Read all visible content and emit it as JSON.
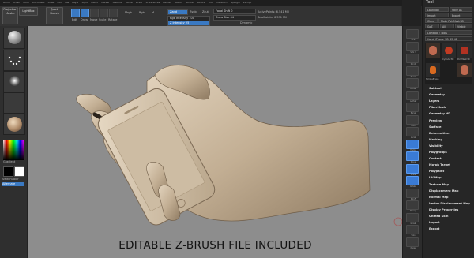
{
  "menu": [
    "Alpha",
    "Brush",
    "Color",
    "Document",
    "Draw",
    "Edit",
    "File",
    "Layer",
    "Light",
    "Macro",
    "Marker",
    "Material",
    "Movie",
    "Picker",
    "Preferences",
    "Render",
    "Stencil",
    "Stroke",
    "Texture",
    "Tool",
    "Transform",
    "Zplugin",
    "Zscript"
  ],
  "toolbar": {
    "projection_master": "Projection Master",
    "lightbox": "LightBox",
    "quick_sketch": "Quick Sketch",
    "edit_label": "Edit",
    "draw_label": "Draw",
    "move_label": "Move",
    "scale_label": "Scale",
    "rotate_label": "Rotate",
    "mrgb": "Mrgb",
    "rgb": "Rgb",
    "m": "M",
    "zadd": "Zadd",
    "zsub": "Zsub",
    "zcut": "Zcut",
    "rgb_intensity": "Rgb Intensity 100",
    "z_intensity": "Z Intensity 25",
    "focal_shift": "Focal Shift 0",
    "draw_size": "Draw Size 64",
    "dynamic": "Dynamic",
    "active_points": "ActivePoints: 6,541 Mil",
    "total_points": "TotalPoints: 6,591 Mil"
  },
  "leftshelf": {
    "gradient_label": "Gradient",
    "switch_color_label": "SwitchColor",
    "alternate_label": "Alternate"
  },
  "caption": "EDITABLE Z-BRUSH FILE INCLUDED",
  "rightcol_labels": [
    "BPR",
    "SPix 3",
    "Scroll",
    "Zoom",
    "Actual",
    "AAHalf",
    "Persp",
    "Floor",
    "Local",
    "Frame",
    "Move",
    "Scale",
    "Rotate",
    "PolyF",
    "Transp",
    "Ghost",
    "Solo",
    "Xpose"
  ],
  "toolpanel": {
    "title": "Tool",
    "buttons": [
      [
        "Load Tool",
        "Save As"
      ],
      [
        "Import",
        "Export"
      ],
      [
        "Clone",
        "Make PolyMesh3D"
      ],
      [
        "GoZ",
        "All",
        "Visible"
      ]
    ],
    "lightbox_tools": "Lightbox › Tools",
    "current_tool": "Hand_iPhone_2B_63_4B",
    "thumbs": [
      "Hand_iPhone",
      "Cylinder3D",
      "PolyMesh3D",
      "SimpleBrush",
      "Hand_iPhone"
    ],
    "menus": [
      "Subtool",
      "Geometry",
      "Layers",
      "FiberMesh",
      "Geometry HD",
      "Preview",
      "Surface",
      "Deformation",
      "Masking",
      "Visibility",
      "Polygroups",
      "Contact",
      "Morph Target",
      "Polypaint",
      "UV Map",
      "Texture Map",
      "Displacement Map",
      "Normal Map",
      "Vector Displacement Map",
      "Display Properties",
      "Unified Skin",
      "Import",
      "Export"
    ]
  },
  "colors": {
    "accent": "#3a79c2",
    "viewport_bg": "#8d8d8d",
    "model_skin": "#c4b299",
    "panel_bg": "#262626"
  }
}
